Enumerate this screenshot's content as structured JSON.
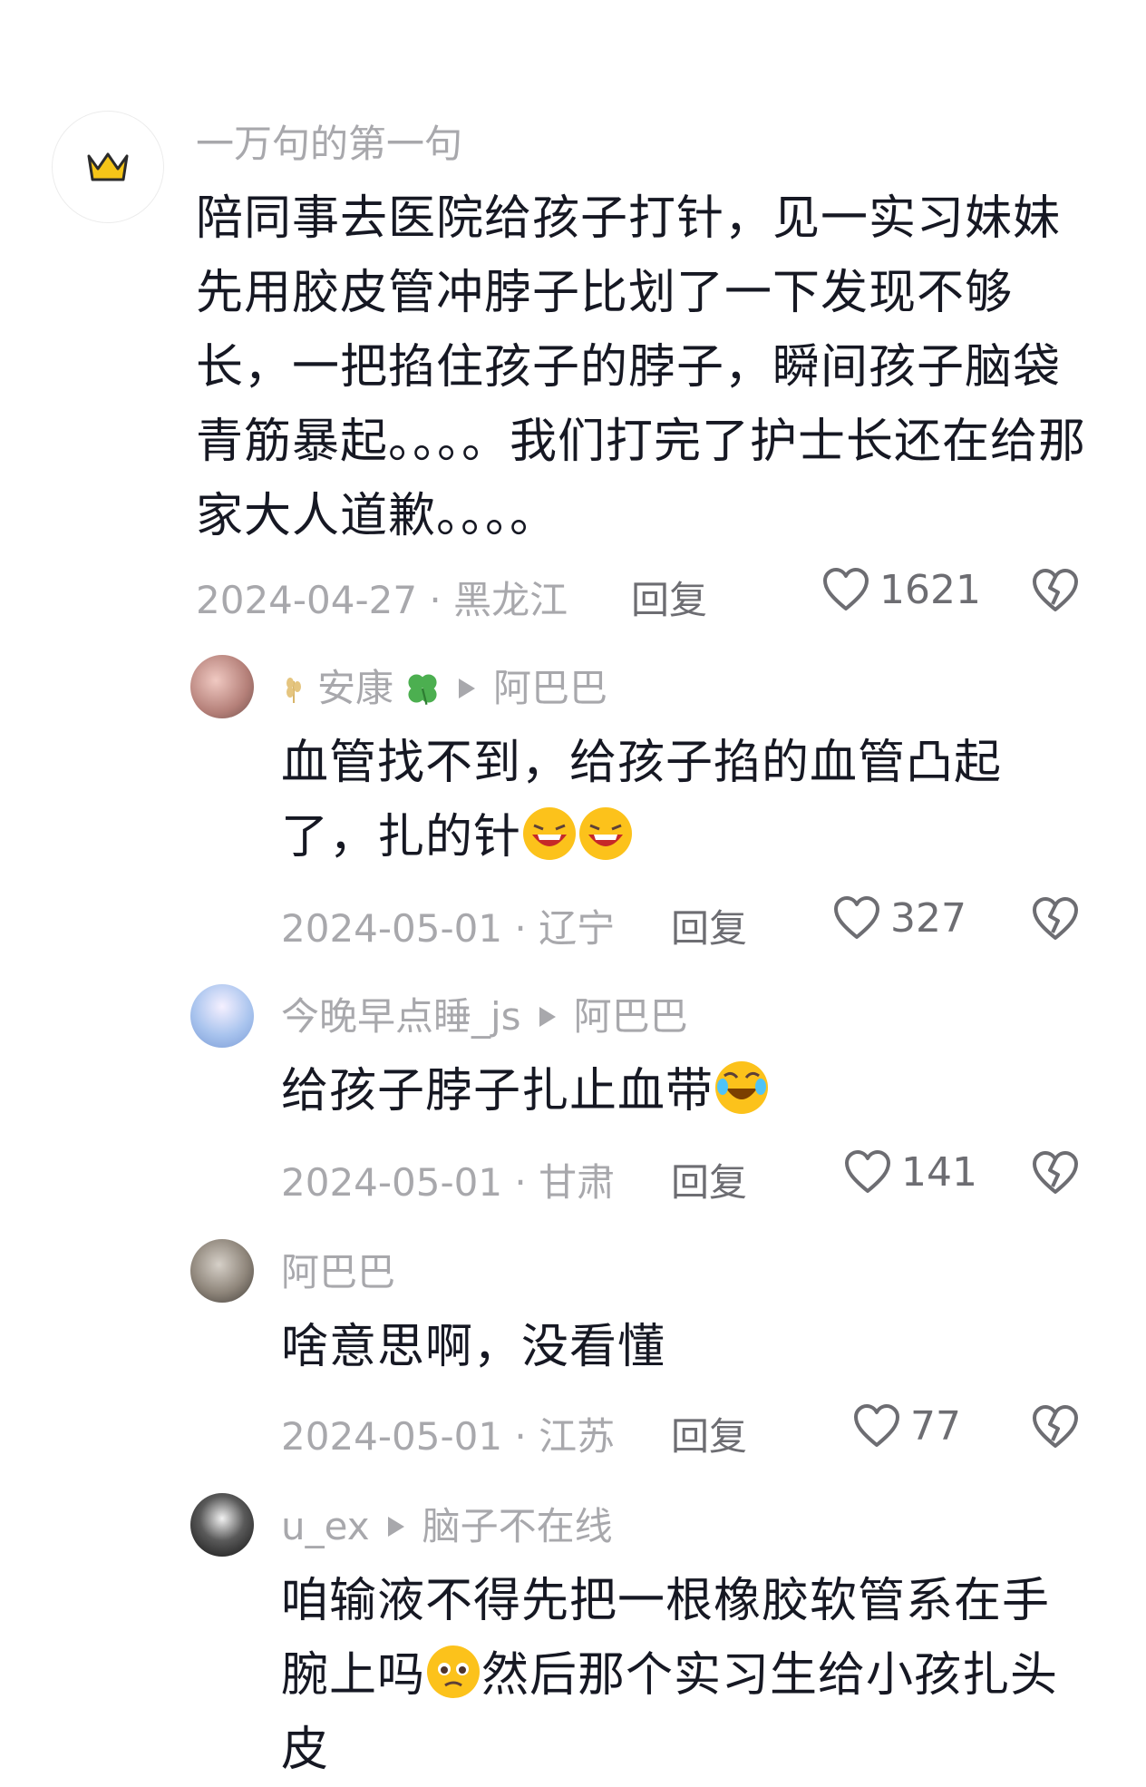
{
  "comments": [
    {
      "username": "一万句的第一句",
      "text": "陪同事去医院给孩子打针，见一实习妹妹先用胶皮管冲脖子比划了一下发现不够长，一把掐住孩子的脖子，瞬间孩子脑袋青筋暴起。。。。我们打完了护士长还在给那家大人道歉。。。。",
      "date_location": "2024-04-27 · 黑龙江",
      "reply_label": "回复",
      "likes": "1621"
    },
    {
      "username": "安康",
      "reply_to": "阿巴巴",
      "text": "血管找不到，给孩子掐的血管凸起了，扎的针",
      "date_location": "2024-05-01 · 辽宁",
      "reply_label": "回复",
      "likes": "327"
    },
    {
      "username": "今晚早点睡_js",
      "reply_to": "阿巴巴",
      "text": "给孩子脖子扎止血带",
      "date_location": "2024-05-01 · 甘肃",
      "reply_label": "回复",
      "likes": "141"
    },
    {
      "username": "阿巴巴",
      "text": "啥意思啊，没看懂",
      "date_location": "2024-05-01 · 江苏",
      "reply_label": "回复",
      "likes": "77"
    },
    {
      "username": "u_ex",
      "reply_to": "脑子不在线",
      "text_part1": "咱输液不得先把一根橡胶软管系在手腕上吗",
      "text_part2": "然后那个实习生给小孩扎头皮"
    }
  ],
  "colors": {
    "text": "#161823",
    "muted": "#a8a8ac",
    "icon": "#6d6d72",
    "crown": "#f5c518"
  }
}
